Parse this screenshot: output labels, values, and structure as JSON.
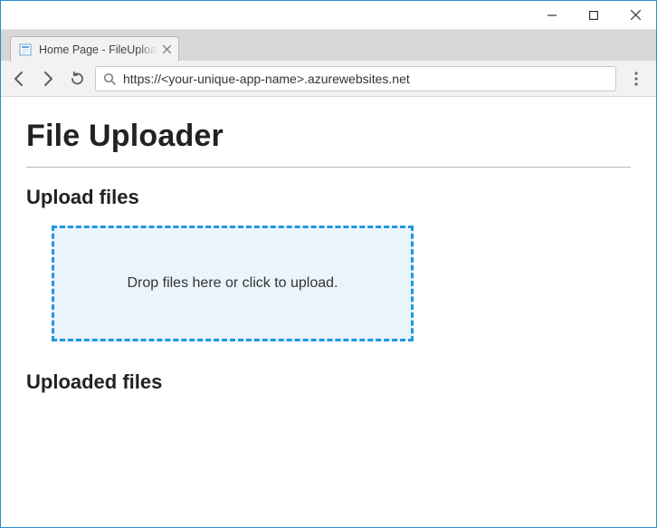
{
  "browser": {
    "tab_title": "Home Page - FileUploade",
    "url": "https://<your-unique-app-name>.azurewebsites.net"
  },
  "page": {
    "title": "File Uploader",
    "upload_section_heading": "Upload files",
    "dropzone_text": "Drop files here or click to upload.",
    "uploaded_section_heading": "Uploaded files"
  }
}
